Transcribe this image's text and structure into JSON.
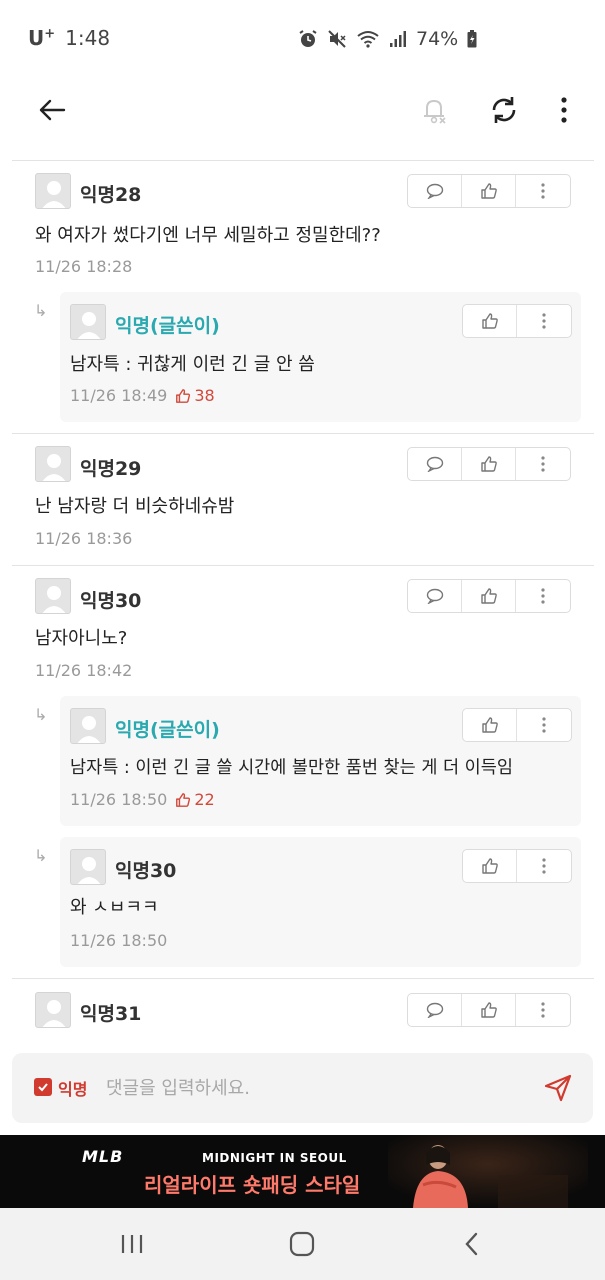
{
  "status_bar": {
    "carrier": "U",
    "carrier_sup": "+",
    "time": "1:48",
    "battery": "74%"
  },
  "header": {
    "back_icon": "back-arrow-icon",
    "notify_icon": "bell-off-icon",
    "refresh_icon": "refresh-icon",
    "more_icon": "more-vertical-icon"
  },
  "comments": [
    {
      "author": "익명28",
      "text": "와 여자가 썼다기엔 너무 세밀하고 정밀한데??",
      "time": "11/26 18:28"
    },
    {
      "author": "익명(글쓴이)",
      "text": "남자특 : 귀찮게 이런 긴 글 안 씀",
      "time": "11/26 18:49",
      "likes": "38"
    },
    {
      "author": "익명29",
      "text": "난 남자랑 더 비슷하네슈밤",
      "time": "11/26 18:36"
    },
    {
      "author": "익명30",
      "text": "남자아니노?",
      "time": "11/26 18:42"
    },
    {
      "author": "익명(글쓴이)",
      "text": "남자특 : 이런 긴 글 쓸 시간에 볼만한 품번 찾는 게 더 이득임",
      "time": "11/26 18:50",
      "likes": "22"
    },
    {
      "author": "익명30",
      "text": "와 ㅅㅂㅋㅋ",
      "time": "11/26 18:50"
    },
    {
      "author": "익명31",
      "text": "",
      "time": ""
    }
  ],
  "input": {
    "anon_label": "익명",
    "placeholder": "댓글을 입력하세요."
  },
  "ad": {
    "brand": "MLB",
    "title": "MIDNIGHT IN SEOUL",
    "subtitle": "리얼라이프 숏패딩 스타일"
  },
  "colors": {
    "accent_red": "#d03a2f",
    "op_teal": "#2aa9b0",
    "like_red": "#d24a3c"
  }
}
